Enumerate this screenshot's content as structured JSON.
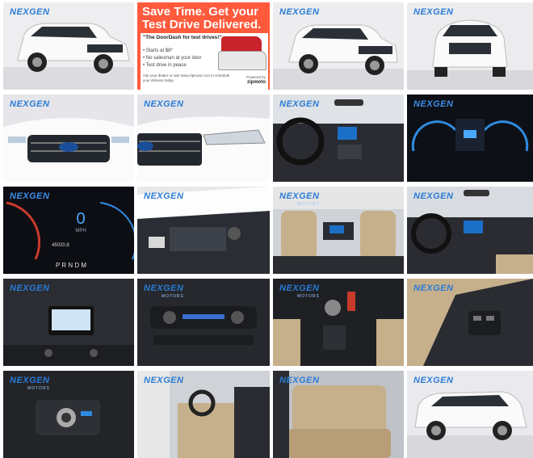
{
  "brand": {
    "logo": "NEXGEN",
    "sub": "MOTORS"
  },
  "ad": {
    "title": "Save Time. Get your Test Drive Delivered.",
    "quote": "\"The DoorDash for test drives!\"",
    "bullets": [
      "Starts at $8*",
      "No salesman at your door",
      "Test drive in peace"
    ],
    "footer": "Ask your dealer or visit www.zipmoto.com to schedule your delivery today",
    "powered_by": "Powered by",
    "powered_brand": "zipmoto"
  },
  "tiles": [
    {
      "name": "photo-exterior-front-3q",
      "logo": true
    },
    {
      "name": "ad-zipmoto",
      "logo": false
    },
    {
      "name": "photo-exterior-front-3q-2",
      "logo": true
    },
    {
      "name": "photo-exterior-front",
      "logo": true
    },
    {
      "name": "photo-grille-closeup",
      "logo": true
    },
    {
      "name": "photo-headlight-closeup",
      "logo": true
    },
    {
      "name": "photo-dashboard",
      "logo": true
    },
    {
      "name": "photo-instrument-cluster",
      "logo": true
    },
    {
      "name": "photo-speedometer",
      "logo": true
    },
    {
      "name": "photo-engine-bay",
      "logo": true
    },
    {
      "name": "photo-rear-seat-view",
      "logo": true
    },
    {
      "name": "photo-cabin-front",
      "logo": true
    },
    {
      "name": "photo-infotainment",
      "logo": true
    },
    {
      "name": "photo-climate-controls",
      "logo": true
    },
    {
      "name": "photo-gear-selector",
      "logo": true
    },
    {
      "name": "photo-door-switches",
      "logo": true
    },
    {
      "name": "photo-headlight-switch",
      "logo": true
    },
    {
      "name": "photo-driver-door-open",
      "logo": true
    },
    {
      "name": "photo-rear-seats",
      "logo": true
    },
    {
      "name": "photo-exterior-side",
      "logo": true
    }
  ],
  "cluster": {
    "speed": "0",
    "unit": "MPH",
    "odometer": "45020.8",
    "gears": "P R N D M"
  }
}
